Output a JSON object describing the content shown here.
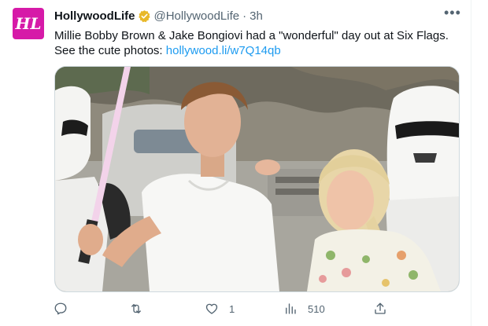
{
  "tweet": {
    "avatar_text": "HL",
    "name": "HollywoodLife",
    "handle": "@HollywoodLife",
    "separator": "·",
    "time": "3h",
    "text": "Millie Bobby Brown & Jake Bongiovi had a \"wonderful\" day out at Six Flags. See the cute photos: ",
    "link": "hollywood.li/w7Q14qb"
  },
  "actions": {
    "reply_count": "",
    "retweet_count": "",
    "like_count": "1",
    "views_count": "510"
  },
  "colors": {
    "brand_pink": "#d61aa8",
    "link_blue": "#1d9bf0",
    "verified_gold": "#e8b829",
    "muted": "#536471"
  },
  "icons": [
    "verified-badge-icon",
    "more-options-icon",
    "reply-icon",
    "retweet-icon",
    "like-icon",
    "views-icon",
    "share-icon"
  ]
}
